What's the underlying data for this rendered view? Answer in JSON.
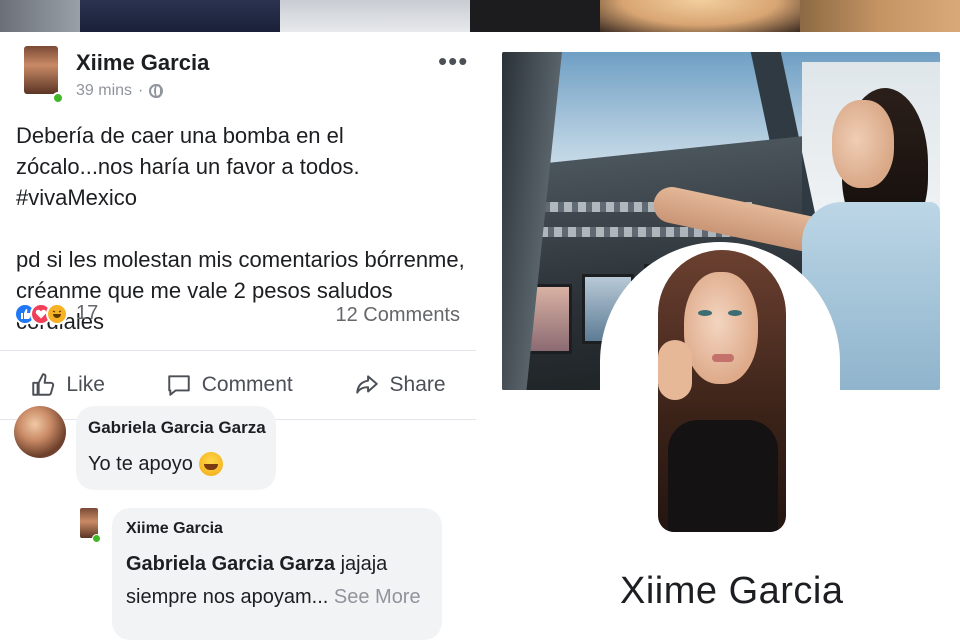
{
  "post": {
    "author": "Xiime Garcia",
    "time": "39 mins",
    "separator": "·",
    "more_icon": "•••",
    "text_line1": "Debería de caer una bomba en el zócalo...nos haría un favor a todos. #vivaMexico",
    "text_line2": "pd si les molestan mis comentarios bórrenme, créanme que me vale 2 pesos  saludos cordiales",
    "reactions": {
      "icons": [
        "like-icon",
        "love-icon",
        "haha-icon"
      ],
      "count": "17"
    },
    "comments_count": "12 Comments",
    "actions": {
      "like": "Like",
      "comment": "Comment",
      "share": "Share"
    }
  },
  "comments": [
    {
      "name": "Gabriela Garcia Garza",
      "text": "Yo te apoyo"
    },
    {
      "name": "Xiime Garcia",
      "tag": "Gabriela Garcia Garza",
      "text": " jajaja siempre nos apoyam...",
      "see_more": " See More"
    }
  ],
  "profile": {
    "name": "Xiime Garcia"
  },
  "colors": {
    "online": "#42b72a",
    "like_blue": "#2078f4",
    "love_red": "#f33e58",
    "haha_yellow": "#f7b125"
  }
}
